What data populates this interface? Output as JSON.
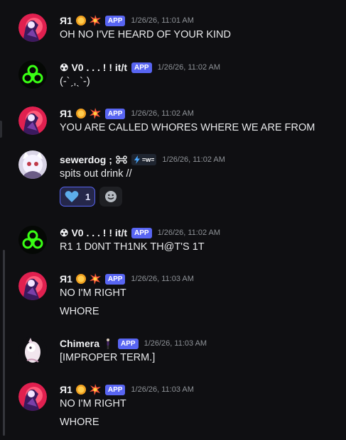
{
  "colors": {
    "background": "#0f0f12",
    "app_tag": "#5865f2",
    "timestamp": "#8e9297",
    "reaction_border": "#5865f2"
  },
  "messages": [
    {
      "user": "Я1",
      "avatar_icon": "red-moon-character-avatar",
      "badges": [
        "coin-emoji",
        "collision-emoji"
      ],
      "tag": "APP",
      "time": "1/26/26, 11:01 AM",
      "lines": [
        "OH NO I'VE HEARD OF YOUR KIND"
      ]
    },
    {
      "user": "☢ V0 . . . ! ! it/t",
      "avatar_icon": "biohazard-avatar",
      "tag": "APP",
      "time": "1/26/26, 11:02 AM",
      "lines": [
        "(-`ˏ,ˎ`-)"
      ]
    },
    {
      "user": "Я1",
      "avatar_icon": "red-moon-character-avatar",
      "badges": [
        "coin-emoji",
        "collision-emoji"
      ],
      "tag": "APP",
      "time": "1/26/26, 11:02 AM",
      "lines": [
        "YOU ARE CALLED WHORES WHERE WE ARE FROM"
      ]
    },
    {
      "user": "sewerdog ;",
      "avatar_icon": "white-cat-character-avatar",
      "badges": [
        "bone-icon"
      ],
      "server_tag": "=w=",
      "time": "1/26/26, 11:02 AM",
      "lines": [
        "spits out drink //"
      ],
      "reaction": {
        "emoji": "blue-heart",
        "count": "1"
      }
    },
    {
      "user": "☢ V0 . . . ! ! it/t",
      "avatar_icon": "biohazard-avatar",
      "tag": "APP",
      "time": "1/26/26, 11:02 AM",
      "lines": [
        "R1 1 D0NT TH1NK TH@T'S 1T"
      ]
    },
    {
      "user": "Я1",
      "avatar_icon": "red-moon-character-avatar",
      "badges": [
        "coin-emoji",
        "collision-emoji"
      ],
      "tag": "APP",
      "time": "1/26/26, 11:03 AM",
      "lines": [
        "NO I'M RIGHT",
        "WHORE"
      ]
    },
    {
      "user": "Chimera",
      "avatar_icon": "chimera-character-avatar",
      "badges": [
        "figure-emoji"
      ],
      "tag": "APP",
      "time": "1/26/26, 11:03 AM",
      "lines": [
        "[IMPROPER TERM.]"
      ]
    },
    {
      "user": "Я1",
      "avatar_icon": "red-moon-character-avatar",
      "badges": [
        "coin-emoji",
        "collision-emoji"
      ],
      "tag": "APP",
      "time": "1/26/26, 11:03 AM",
      "lines": [
        "NO I'M RIGHT",
        "WHORE"
      ]
    }
  ]
}
